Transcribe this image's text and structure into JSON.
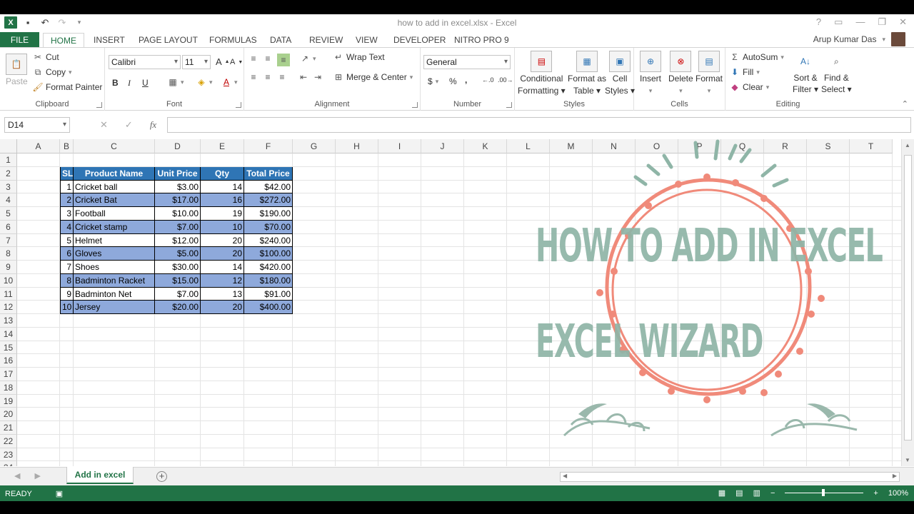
{
  "window": {
    "title": "how to add in excel.xlsx - Excel",
    "controls": [
      "?",
      "▭",
      "—",
      "❐",
      "✕"
    ]
  },
  "tabs": [
    "FILE",
    "HOME",
    "INSERT",
    "PAGE LAYOUT",
    "FORMULAS",
    "DATA",
    "REVIEW",
    "VIEW",
    "DEVELOPER",
    "NITRO PRO 9"
  ],
  "user": {
    "name": "Arup Kumar Das"
  },
  "ribbon": {
    "clipboard": {
      "label": "Clipboard",
      "paste": "Paste",
      "cut": "Cut",
      "copy": "Copy",
      "format_painter": "Format Painter"
    },
    "font": {
      "label": "Font",
      "name": "Calibri",
      "size": "11",
      "bold": "B",
      "italic": "I",
      "underline": "U"
    },
    "alignment": {
      "label": "Alignment",
      "wrap_text": "Wrap Text",
      "merge_center": "Merge & Center"
    },
    "number": {
      "label": "Number",
      "format": "General",
      "currency": "$",
      "percent": "%",
      "comma": ","
    },
    "styles": {
      "label": "Styles",
      "conditional_1": "Conditional",
      "conditional_2": "Formatting ▾",
      "format_table_1": "Format as",
      "format_table_2": "Table ▾",
      "cell_styles_1": "Cell",
      "cell_styles_2": "Styles ▾"
    },
    "cells": {
      "label": "Cells",
      "insert": "Insert",
      "delete": "Delete",
      "format": "Format"
    },
    "editing": {
      "label": "Editing",
      "autosum": "AutoSum",
      "fill": "Fill",
      "clear": "Clear",
      "sort_1": "Sort &",
      "sort_2": "Filter ▾",
      "find_1": "Find &",
      "find_2": "Select ▾"
    }
  },
  "formula_bar": {
    "name_box": "D14",
    "fx": "fx",
    "value": ""
  },
  "columns": [
    "A",
    "B",
    "C",
    "D",
    "E",
    "F",
    "G",
    "H",
    "I",
    "J",
    "K",
    "L",
    "M",
    "N",
    "O",
    "P",
    "Q",
    "R",
    "S",
    "T"
  ],
  "rows": [
    "1",
    "2",
    "3",
    "4",
    "5",
    "6",
    "7",
    "8",
    "9",
    "10",
    "11",
    "12",
    "13",
    "14",
    "15",
    "16",
    "17",
    "18",
    "19",
    "20",
    "21",
    "22",
    "23",
    "24"
  ],
  "table": {
    "headers": [
      "SL",
      "Product Name",
      "Unit Price",
      "Qty",
      "Total Price"
    ],
    "rows": [
      [
        "1",
        "Cricket ball",
        "$3.00",
        "14",
        "$42.00"
      ],
      [
        "2",
        "Cricket Bat",
        "$17.00",
        "16",
        "$272.00"
      ],
      [
        "3",
        "Football",
        "$10.00",
        "19",
        "$190.00"
      ],
      [
        "4",
        "Cricket stamp",
        "$7.00",
        "10",
        "$70.00"
      ],
      [
        "5",
        "Helmet",
        "$12.00",
        "20",
        "$240.00"
      ],
      [
        "6",
        "Gloves",
        "$5.00",
        "20",
        "$100.00"
      ],
      [
        "7",
        "Shoes",
        "$30.00",
        "14",
        "$420.00"
      ],
      [
        "8",
        "Badminton Racket",
        "$15.00",
        "12",
        "$180.00"
      ],
      [
        "9",
        "Badminton Net",
        "$7.00",
        "13",
        "$91.00"
      ],
      [
        "10",
        "Jersey",
        "$20.00",
        "20",
        "$400.00"
      ]
    ]
  },
  "overlay": {
    "title": "HOW TO ADD IN EXCEL",
    "subtitle": "EXCEL WIZARD"
  },
  "sheet": {
    "active_tab": "Add in excel",
    "add": "+"
  },
  "status": {
    "ready": "READY",
    "zoom": "100%"
  },
  "colors": {
    "accent": "#217346",
    "header_fill": "#2f75b5",
    "band_fill": "#8ea9db",
    "overlay_text": "#8fb5a7",
    "overlay_wreath": "#f08a7a"
  }
}
